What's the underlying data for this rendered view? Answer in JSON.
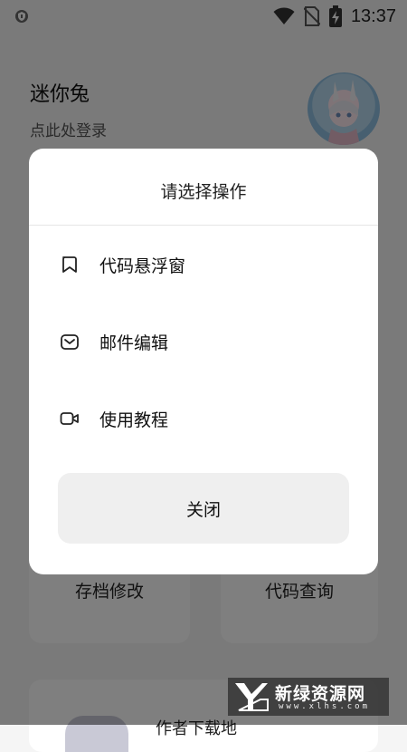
{
  "status_bar": {
    "time": "13:37",
    "left_icon": "shield-icon",
    "icons": [
      "wifi-icon",
      "no-sim-icon",
      "battery-charging-icon"
    ]
  },
  "profile": {
    "name": "迷你兔",
    "login_prompt": "点此处登录",
    "avatar": "anime-avatar"
  },
  "cards": {
    "save_edit": "存档修改",
    "code_query": "代码查询",
    "bottom_partial": "作者下载地"
  },
  "dialog": {
    "title": "请选择操作",
    "options": [
      {
        "label": "代码悬浮窗",
        "icon": "bookmark-icon"
      },
      {
        "label": "邮件编辑",
        "icon": "mail-icon"
      },
      {
        "label": "使用教程",
        "icon": "video-icon"
      }
    ],
    "close_label": "关闭"
  },
  "watermark": {
    "text": "新绿资源网",
    "url": "www.xlhs.com"
  },
  "colors": {
    "overlay": "rgba(0,0,0,0.5)",
    "dialog_bg": "#ffffff",
    "close_bg": "#efefef",
    "page_bg": "#f5f5f5"
  }
}
